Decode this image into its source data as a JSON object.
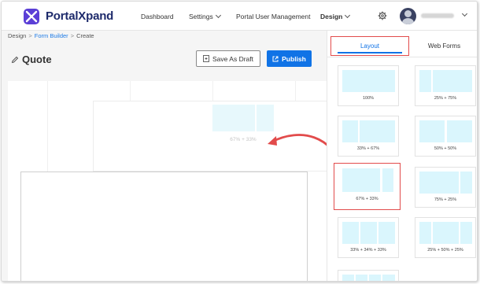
{
  "brand": {
    "name": "PortalXpand"
  },
  "nav": {
    "dashboard": "Dashboard",
    "settings": "Settings",
    "portal_user_management": "Portal User Management",
    "design": "Design"
  },
  "breadcrumb": {
    "design": "Design",
    "form_builder": "Form Builder",
    "create": "Create"
  },
  "editor": {
    "title": "Quote",
    "save_draft": "Save As Draft",
    "publish": "Publish",
    "drop_preview_label": "67% + 33%"
  },
  "panel": {
    "tabs": [
      "Layout",
      "Web Forms"
    ],
    "active_tab": "Layout",
    "layouts": [
      {
        "label": "100%"
      },
      {
        "label": "25% + 75%"
      },
      {
        "label": "33% + 67%"
      },
      {
        "label": "50% + 50%"
      },
      {
        "label": "67% + 33%",
        "highlighted": true
      },
      {
        "label": "75% + 25%"
      },
      {
        "label": "33% + 34% + 33%"
      },
      {
        "label": "25% + 50% + 25%"
      }
    ]
  },
  "colors": {
    "accent": "#1073e6",
    "brand": "#1d2a6b",
    "highlight": "#e24b4b",
    "cell": "#daf6fd"
  }
}
